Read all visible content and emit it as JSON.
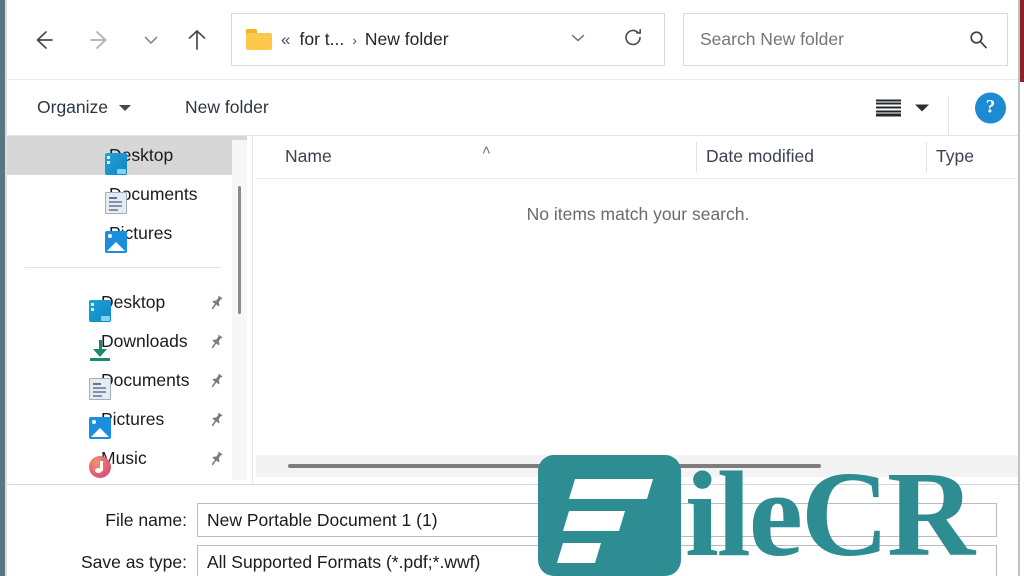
{
  "window": {
    "accent_red": "#8d2327",
    "border_color": "#5b7682"
  },
  "navbar": {
    "back_icon": "arrow-left-icon",
    "forward_icon": "arrow-right-icon",
    "recent_icon": "chevron-down-icon",
    "up_icon": "arrow-up-icon",
    "breadcrumb": {
      "folder_icon": "folder-icon",
      "overflow": "«",
      "parent": "for t...",
      "separator": "›",
      "current": "New folder",
      "dropdown_icon": "chevron-down-icon",
      "refresh_icon": "refresh-icon"
    },
    "search": {
      "placeholder": "Search New folder",
      "value": "",
      "icon": "search-icon"
    }
  },
  "toolbar": {
    "organize_label": "Organize",
    "new_folder_label": "New folder",
    "view_icon": "list-view-icon",
    "view_caret_icon": "chevron-down-icon",
    "help_label": "?",
    "help_color": "#1f8ad4"
  },
  "sidebar": {
    "top_items": [
      {
        "label": "Desktop",
        "icon": "desktop-icon",
        "selected": true
      },
      {
        "label": "Documents",
        "icon": "documents-icon",
        "selected": false
      },
      {
        "label": "Pictures",
        "icon": "pictures-icon",
        "selected": false
      }
    ],
    "quick_access_items": [
      {
        "label": "Desktop",
        "icon": "desktop-icon",
        "pin": "pin-icon"
      },
      {
        "label": "Downloads",
        "icon": "downloads-icon",
        "pin": "pin-icon"
      },
      {
        "label": "Documents",
        "icon": "documents-icon",
        "pin": "pin-icon"
      },
      {
        "label": "Pictures",
        "icon": "pictures-icon",
        "pin": "pin-icon"
      },
      {
        "label": "Music",
        "icon": "music-icon",
        "pin": "pin-icon"
      }
    ]
  },
  "file_list": {
    "columns": [
      {
        "label": "Name",
        "sorted": true,
        "sort_icon": "chevron-up-icon"
      },
      {
        "label": "Date modified",
        "sorted": false
      },
      {
        "label": "Type",
        "sorted": false
      }
    ],
    "sort_caret": "˄",
    "empty_message": "No items match your search.",
    "rows": []
  },
  "bottom": {
    "file_name_label": "File name:",
    "file_name_value": "New Portable Document 1 (1)",
    "save_as_type_label": "Save as type:",
    "save_as_type_value": "All Supported Formats (*.pdf;*.wwf)"
  },
  "watermark": {
    "text": "ileCR",
    "color": "#2e8c93"
  }
}
